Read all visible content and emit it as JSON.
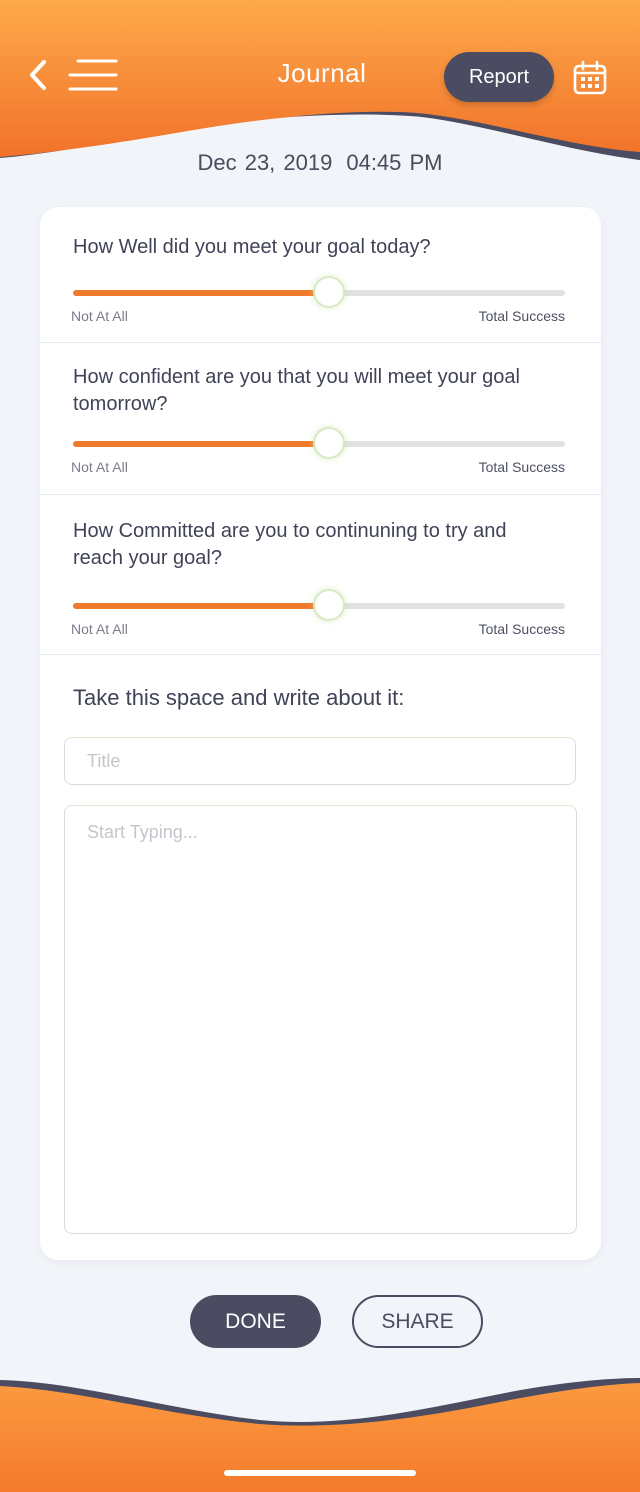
{
  "header": {
    "title": "Journal",
    "report_label": "Report"
  },
  "entry": {
    "date": "Dec 23, 2019",
    "time": "04:45 PM"
  },
  "questions": [
    {
      "text": "How Well did you meet your goal today?",
      "value": 0.52,
      "min_label": "Not At All",
      "max_label": "Total Success"
    },
    {
      "text": "How confident are you that you will meet your goal tomorrow?",
      "value": 0.52,
      "min_label": "Not At All",
      "max_label": "Total Success"
    },
    {
      "text": "How Committed are you to continuning to try and reach your goal?",
      "value": 0.52,
      "min_label": "Not At All",
      "max_label": "Total Success"
    }
  ],
  "journal": {
    "prompt": "Take this space and write about it:",
    "title_placeholder": "Title",
    "body_placeholder": "Start Typing..."
  },
  "actions": {
    "done_label": "DONE",
    "share_label": "SHARE"
  },
  "colors": {
    "accent_orange": "#f07a2c",
    "dark_slate": "#4b4c62",
    "background": "#f1f4f8"
  },
  "icons": {
    "back": "chevron-left-icon",
    "menu": "hamburger-menu-icon",
    "calendar": "calendar-icon"
  }
}
